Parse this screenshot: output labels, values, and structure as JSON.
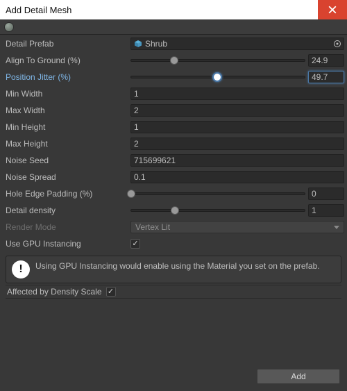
{
  "window": {
    "title": "Add Detail Mesh"
  },
  "fields": {
    "detail_prefab": {
      "label": "Detail Prefab",
      "value": "Shrub"
    },
    "align_to_ground": {
      "label": "Align To Ground (%)",
      "value": "24.9",
      "percent": 24.9
    },
    "position_jitter": {
      "label": "Position Jitter (%)",
      "value": "49.7",
      "percent": 49.7
    },
    "min_width": {
      "label": "Min Width",
      "value": "1"
    },
    "max_width": {
      "label": "Max Width",
      "value": "2"
    },
    "min_height": {
      "label": "Min Height",
      "value": "1"
    },
    "max_height": {
      "label": "Max Height",
      "value": "2"
    },
    "noise_seed": {
      "label": "Noise Seed",
      "value": "715699621"
    },
    "noise_spread": {
      "label": "Noise Spread",
      "value": "0.1"
    },
    "hole_edge_padding": {
      "label": "Hole Edge Padding (%)",
      "value": "0",
      "percent": 0
    },
    "detail_density": {
      "label": "Detail density",
      "value": "1",
      "percent": 25
    },
    "render_mode": {
      "label": "Render Mode",
      "value": "Vertex Lit"
    },
    "use_gpu_instancing": {
      "label": "Use GPU Instancing",
      "checked": true
    },
    "affected_by_density": {
      "label": "Affected by Density Scale",
      "checked": true
    }
  },
  "info": {
    "text": "Using GPU Instancing would enable using the Material you set on the prefab."
  },
  "buttons": {
    "add": "Add"
  }
}
